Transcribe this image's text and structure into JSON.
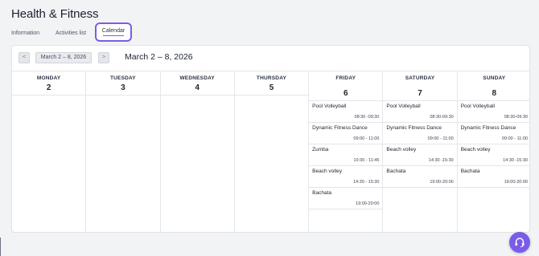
{
  "page": {
    "title": "Health & Fitness"
  },
  "tabs": [
    {
      "label": "Information"
    },
    {
      "label": "Activities list"
    },
    {
      "label": "Calendar",
      "active": true
    }
  ],
  "toolbar": {
    "prev_label": "<",
    "next_label": ">",
    "range_label": "March 2 – 8, 2026",
    "range_title": "March 2 – 8, 2026"
  },
  "days": [
    {
      "name": "MONDAY",
      "num": "2",
      "events": []
    },
    {
      "name": "TUESDAY",
      "num": "3",
      "events": []
    },
    {
      "name": "WEDNESDAY",
      "num": "4",
      "events": []
    },
    {
      "name": "THURSDAY",
      "num": "5",
      "events": []
    },
    {
      "name": "FRIDAY",
      "num": "6",
      "events": [
        {
          "name": "Pool Volleyball",
          "time": "08:30 -09:30"
        },
        {
          "name": "Dynamic Fitness Dance",
          "time": "09:00 - 11:00"
        },
        {
          "name": "Zumba",
          "time": "10:30 - 11:45"
        },
        {
          "name": "Beach volley",
          "time": "14:30 - 15:30"
        },
        {
          "name": "Bachata",
          "time": "19:00-20:00"
        }
      ]
    },
    {
      "name": "SATURDAY",
      "num": "7",
      "events": [
        {
          "name": "Pool Volleyball",
          "time": "08:30-09:30"
        },
        {
          "name": "Dynamic Fitness Dance",
          "time": "09:00 - 11:00"
        },
        {
          "name": "Beach volley",
          "time": "14:30 -15:30"
        },
        {
          "name": "Bachata",
          "time": "19:00-20:00"
        }
      ]
    },
    {
      "name": "SUNDAY",
      "num": "8",
      "events": [
        {
          "name": "Pool Volleyball",
          "time": "08:30-09:30"
        },
        {
          "name": "Dynamic Fitness Dance",
          "time": "09:00 - 11:00"
        },
        {
          "name": "Beach volley",
          "time": "14:30 -15:30"
        },
        {
          "name": "Bachata",
          "time": "19:00-20:00"
        }
      ]
    }
  ],
  "support": {
    "icon": "headset-icon"
  },
  "colors": {
    "accent": "#7a5ce8",
    "background": "#f2f3f5",
    "border": "#e4e6ea"
  }
}
